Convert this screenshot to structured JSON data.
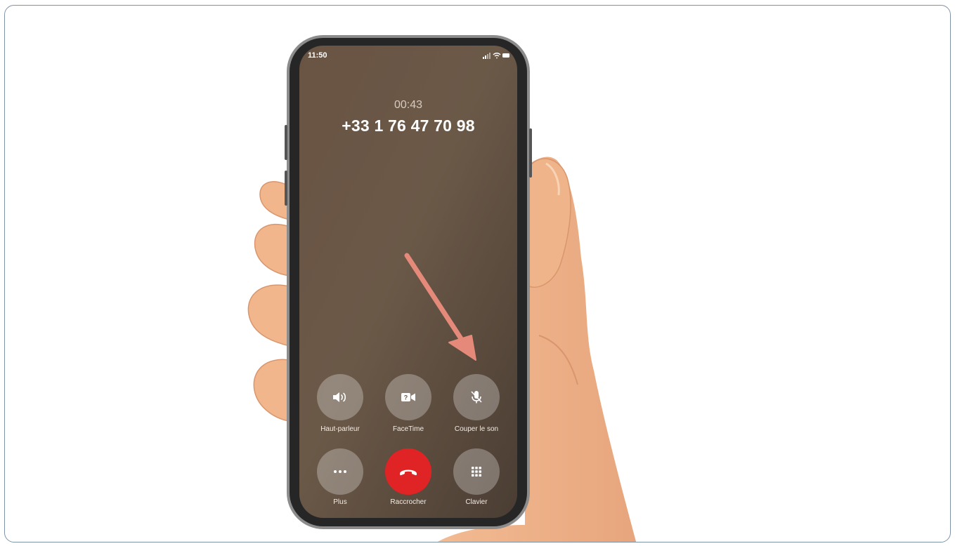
{
  "status_bar": {
    "time": "11:50"
  },
  "call": {
    "timer": "00:43",
    "number": "+33 1 76 47 70 98"
  },
  "controls": [
    {
      "label": "Haut-parleur",
      "icon": "speaker-icon"
    },
    {
      "label": "FaceTime",
      "icon": "facetime-icon"
    },
    {
      "label": "Couper le son",
      "icon": "mute-microphone-icon"
    },
    {
      "label": "Plus",
      "icon": "more-icon"
    },
    {
      "label": "Raccrocher",
      "icon": "hang-up-icon"
    },
    {
      "label": "Clavier",
      "icon": "keypad-icon"
    }
  ],
  "colors": {
    "hang_up": "#e02324",
    "arrow": "#e58a7a",
    "skin": "#f2b98f"
  }
}
